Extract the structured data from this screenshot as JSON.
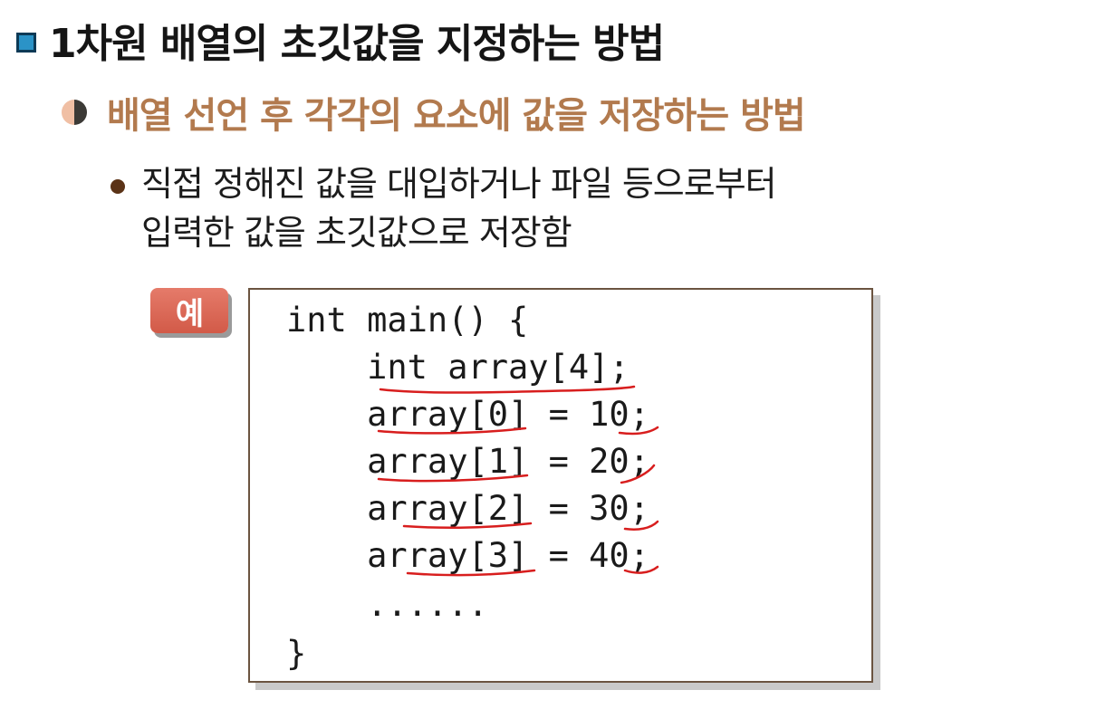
{
  "title": "1차원 배열의 초깃값을 지정하는 방법",
  "subtitle": "배열 선언 후 각각의 요소에 값을 저장하는 방법",
  "description": {
    "line1": "직접 정해진 값을 대입하거나 파일 등으로부터",
    "line2": "입력한 값을 초깃값으로 저장함"
  },
  "example_label": "예",
  "code": {
    "line1": "int main() {",
    "line2": "    int array[4];",
    "line3": "    array[0] = 10;",
    "line4": "    array[1] = 20;",
    "line5": "    array[2] = 30;",
    "line6": "    array[3] = 40;",
    "line7": "    ......",
    "line8": "}"
  },
  "colors": {
    "title_bullet": "#2b93c7",
    "subtitle": "#b27a4e",
    "example_badge": "#d86a58",
    "annotation_ink": "#d81e1e"
  }
}
